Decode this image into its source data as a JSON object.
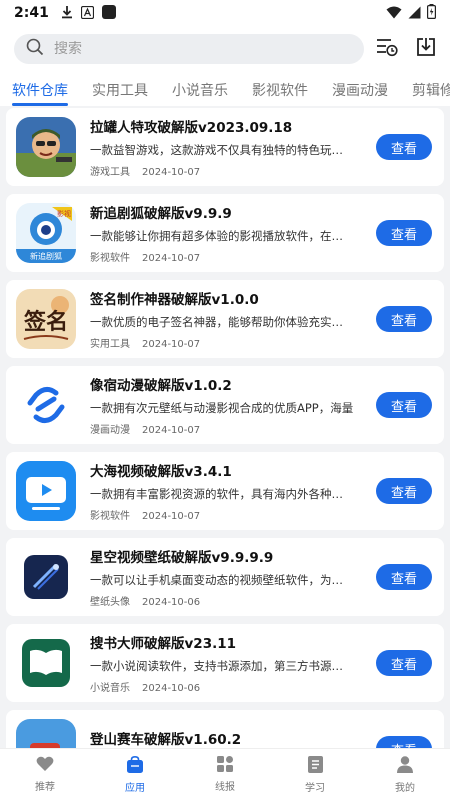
{
  "status": {
    "time": "2:41"
  },
  "search": {
    "placeholder": "搜索"
  },
  "tabs": [
    "软件仓库",
    "实用工具",
    "小说音乐",
    "影视软件",
    "漫画动漫",
    "剪辑修图"
  ],
  "apps": [
    {
      "title": "拉罐人特攻破解版v2023.09.18",
      "desc": "一款益智游戏，这款游戏不仅具有独特的特色玩法，",
      "category": "游戏工具",
      "date": "2024-10-07",
      "button": "查看",
      "icon": "game-soldier-icon"
    },
    {
      "title": "新追剧狐破解版v9.9.9",
      "desc": "一款能够让你拥有超多体验的影视播放软件，在这里",
      "category": "影视软件",
      "date": "2024-10-07",
      "button": "查看",
      "icon": "fox-tv-icon",
      "icon_text": "新追剧狐",
      "icon_badge": "影视"
    },
    {
      "title": "签名制作神器破解版v1.0.0",
      "desc": "一款优质的电子签名神器，能够帮助你体验充实简单",
      "category": "实用工具",
      "date": "2024-10-07",
      "button": "查看",
      "icon": "signature-icon",
      "icon_text": "签名"
    },
    {
      "title": "像宿动漫破解版v1.0.2",
      "desc": "一款拥有次元壁纸与动漫影视合成的优质APP，海量",
      "category": "漫画动漫",
      "date": "2024-10-07",
      "button": "查看",
      "icon": "s-logo-icon"
    },
    {
      "title": "大海视频破解版v3.4.1",
      "desc": "一款拥有丰富影视资源的软件，具有海内外各种题材",
      "category": "影视软件",
      "date": "2024-10-07",
      "button": "查看",
      "icon": "video-play-icon"
    },
    {
      "title": "星空视频壁纸破解版v9.9.9.9",
      "desc": "一款可以让手机桌面变动态的视频壁纸软件，为用户",
      "category": "壁纸头像",
      "date": "2024-10-06",
      "button": "查看",
      "icon": "star-wallpaper-icon"
    },
    {
      "title": "搜书大师破解版v23.11",
      "desc": "一款小说阅读软件，支持书源添加，第三方书源导入",
      "category": "小说音乐",
      "date": "2024-10-06",
      "button": "查看",
      "icon": "book-icon"
    },
    {
      "title": "登山赛车破解版v1.60.2",
      "desc": "",
      "category": "",
      "date": "",
      "button": "查看",
      "icon": "hill-racing-icon"
    }
  ],
  "nav": [
    {
      "label": "推荐",
      "icon": "heart-icon"
    },
    {
      "label": "应用",
      "icon": "app-bag-icon"
    },
    {
      "label": "线报",
      "icon": "grid-icon"
    },
    {
      "label": "学习",
      "icon": "notebook-icon"
    },
    {
      "label": "我的",
      "icon": "person-icon"
    }
  ],
  "nav_active": 1,
  "tab_active": 0,
  "colors": {
    "accent": "#1e6be6",
    "background": "#f2f3f5"
  }
}
